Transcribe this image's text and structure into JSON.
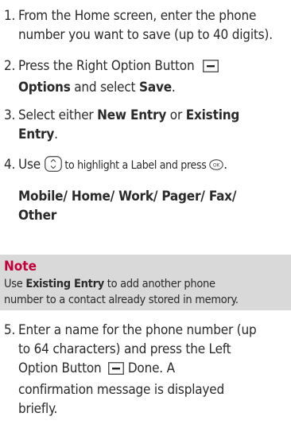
{
  "steps": [
    {
      "number": "1.",
      "line1": "From the Home screen, enter the phone",
      "line2": "number you want to save (up to 40 digits)."
    },
    {
      "number": "2.",
      "line1_pre": "Press the Right Option Button",
      "line2_bold1": "Options",
      "line2_mid": " and select ",
      "line2_bold2": "Save",
      "line2_end": "."
    },
    {
      "number": "3.",
      "line1_pre": "Select either ",
      "line1_bold1": "New Entry",
      "line1_mid": " or ",
      "line1_bold2": "Existing",
      "line2_bold": "Entry",
      "line2_end": "."
    },
    {
      "number": "4.",
      "line1_pre": "Use ",
      "line1_mid": " to highlight a Label and press ",
      "line1_end": ".",
      "labels_line1": "Mobile/ Home/ Work/ Pager/ Fax/",
      "labels_line2": "Other"
    },
    {
      "number": "5.",
      "line1": "Enter a name for the phone number (up",
      "line2": "to 64 characters) and press the Left",
      "line3_pre": "Option Button",
      "line3_end": " Done. A",
      "line4": "confirmation message is displayed",
      "line5": "briefly."
    }
  ],
  "note": {
    "title": "Note",
    "text1_pre": "Use ",
    "text1_bold": "Existing Entry",
    "text1_end": " to add another phone",
    "text2": "number to a contact already stored in memory."
  },
  "icons": {
    "option_button": "option-button-icon",
    "nav_key": "navigation-key-icon",
    "ok_key": "ok-key-icon"
  },
  "colors": {
    "note_title": "#c4003c",
    "note_background": "#d9d9d9",
    "text": "#2a2a2a"
  }
}
